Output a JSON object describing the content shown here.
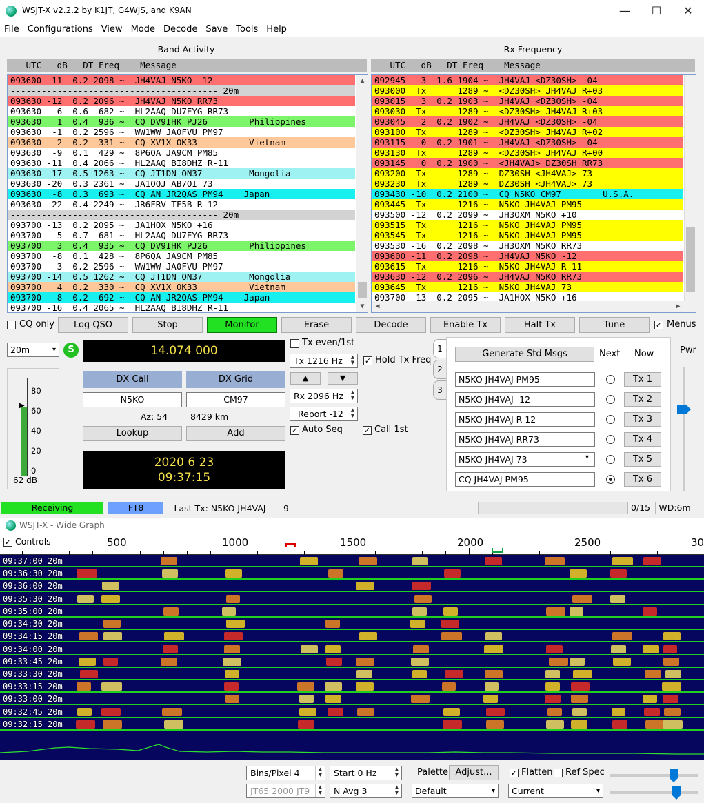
{
  "window": {
    "title": "WSJT-X   v2.2.2   by K1JT, G4WJS, and K9AN",
    "minimize": "—",
    "maximize": "☐",
    "close": "✕"
  },
  "menu": [
    "File",
    "Configurations",
    "View",
    "Mode",
    "Decode",
    "Save",
    "Tools",
    "Help"
  ],
  "band_activity": {
    "label": "Band Activity",
    "header": " UTC   dB   DT Freq    Message",
    "rows": [
      {
        "text": "093600 -11  0.2 2098 ~  JH4VAJ N5KO -12",
        "bg": "#ff6f6f"
      },
      {
        "text": "---------------------------------------- 20m",
        "bg": "#d3d3d3"
      },
      {
        "text": "093630 -12  0.2 2096 ~  JH4VAJ N5KO RR73",
        "bg": "#ff6f6f"
      },
      {
        "text": "093630   6  0.6  682 ~  HL2AAQ DU7EYG RR73",
        "bg": "#ffffff"
      },
      {
        "text": "093630   1  0.4  936 ~  CQ DV9IHK PJ26        Philippines",
        "bg": "#7cf56a"
      },
      {
        "text": "093630  -1  0.2 2596 ~  WW1WW JA0FVU PM97",
        "bg": "#ffffff"
      },
      {
        "text": "093630   2  0.2  331 ~  CQ XV1X OK33          Vietnam",
        "bg": "#ffc89a"
      },
      {
        "text": "093630  -9  0.1  429 ~  8P6QA JA9CM PM85",
        "bg": "#ffffff"
      },
      {
        "text": "093630 -11  0.4 2066 ~  HL2AAQ BI8DHZ R-11",
        "bg": "#ffffff"
      },
      {
        "text": "093630 -17  0.5 1263 ~  CQ JT1DN ON37         Mongolia",
        "bg": "#9ff2f2"
      },
      {
        "text": "093630 -20  0.3 2361 ~  JA1OQJ AB7OI 73",
        "bg": "#ffffff"
      },
      {
        "text": "093630  -8  0.3  693 ~  CQ AN JR2QAS PM94    Japan",
        "bg": "#18f0f0"
      },
      {
        "text": "093630 -22  0.4 2249 ~  JR6FRV TF5B R-12",
        "bg": "#ffffff"
      },
      {
        "text": "---------------------------------------- 20m",
        "bg": "#d3d3d3"
      },
      {
        "text": "093700 -13  0.2 2095 ~  JA1HOX N5KO +16",
        "bg": "#ffffff"
      },
      {
        "text": "093700   5  0.7  681 ~  HL2AAQ DU7EYG RR73",
        "bg": "#ffffff"
      },
      {
        "text": "093700   3  0.4  935 ~  CQ DV9IHK PJ26        Philippines",
        "bg": "#7cf56a"
      },
      {
        "text": "093700  -8  0.1  428 ~  8P6QA JA9CM PM85",
        "bg": "#ffffff"
      },
      {
        "text": "093700  -3  0.2 2596 ~  WW1WW JA0FVU PM97",
        "bg": "#ffffff"
      },
      {
        "text": "093700 -14  0.5 1262 ~  CQ JT1DN ON37         Mongolia",
        "bg": "#9ff2f2"
      },
      {
        "text": "093700   4  0.2  330 ~  CQ XV1X OK33          Vietnam",
        "bg": "#ffc89a"
      },
      {
        "text": "093700  -8  0.2  692 ~  CQ AN JR2QAS PM94    Japan",
        "bg": "#18f0f0"
      },
      {
        "text": "093700 -16  0.4 2065 ~  HL2AAQ BI8DHZ R-11",
        "bg": "#ffffff"
      }
    ]
  },
  "rx_frequency": {
    "label": "Rx Frequency",
    "header": " UTC   dB   DT Freq    Message",
    "rows": [
      {
        "text": "092945   3 -1.6 1904 ~  JH4VAJ <DZ30SH> -04",
        "bg": "#ff6f6f"
      },
      {
        "text": "093000  Tx      1289 ~  <DZ30SH> JH4VAJ R+03",
        "bg": "#ffff00"
      },
      {
        "text": "093015   3  0.2 1903 ~  JH4VAJ <DZ30SH> -04",
        "bg": "#ff6f6f"
      },
      {
        "text": "093030  Tx      1289 ~  <DZ30SH> JH4VAJ R+03",
        "bg": "#ffff00"
      },
      {
        "text": "093045   2  0.2 1902 ~  JH4VAJ <DZ30SH> -04",
        "bg": "#ff6f6f"
      },
      {
        "text": "093100  Tx      1289 ~  <DZ30SH> JH4VAJ R+02",
        "bg": "#ffff00"
      },
      {
        "text": "093115   0  0.2 1901 ~  JH4VAJ <DZ30SH> -04",
        "bg": "#ff6f6f"
      },
      {
        "text": "093130  Tx      1289 ~  <DZ30SH> JH4VAJ R+00",
        "bg": "#ffff00"
      },
      {
        "text": "093145   0  0.2 1900 ~  <JH4VAJ> DZ30SH RR73",
        "bg": "#ff6f6f"
      },
      {
        "text": "093200  Tx      1289 ~  DZ30SH <JH4VAJ> 73",
        "bg": "#ffff00"
      },
      {
        "text": "093230  Tx      1289 ~  DZ30SH <JH4VAJ> 73",
        "bg": "#ffff00"
      },
      {
        "text": "093430 -10  0.2 2100 ~  CQ N5KO CM97        U.S.A.",
        "bg": "#18f0f0"
      },
      {
        "text": "093445  Tx      1216 ~  N5KO JH4VAJ PM95",
        "bg": "#ffff00"
      },
      {
        "text": "093500 -12  0.2 2099 ~  JH3OXM N5KO +10",
        "bg": "#ffffff"
      },
      {
        "text": "093515  Tx      1216 ~  N5KO JH4VAJ PM95",
        "bg": "#ffff00"
      },
      {
        "text": "093545  Tx      1216 ~  N5KO JH4VAJ PM95",
        "bg": "#ffff00"
      },
      {
        "text": "093530 -16  0.2 2098 ~  JH3OXM N5KO RR73",
        "bg": "#ffffff"
      },
      {
        "text": "093600 -11  0.2 2098 ~  JH4VAJ N5KO -12",
        "bg": "#ff6f6f"
      },
      {
        "text": "093615  Tx      1216 ~  N5KO JH4VAJ R-11",
        "bg": "#ffff00"
      },
      {
        "text": "093630 -12  0.2 2096 ~  JH4VAJ N5KO RR73",
        "bg": "#ff6f6f"
      },
      {
        "text": "093645  Tx      1216 ~  N5KO JH4VAJ 73",
        "bg": "#ffff00"
      },
      {
        "text": "093700 -13  0.2 2095 ~  JA1HOX N5KO +16",
        "bg": "#ffffff"
      }
    ]
  },
  "controls_row": {
    "cq_only": "CQ only",
    "log_qso": "Log QSO",
    "stop": "Stop",
    "monitor": "Monitor",
    "erase": "Erase",
    "decode": "Decode",
    "enable_tx": "Enable Tx",
    "halt_tx": "Halt Tx",
    "tune": "Tune",
    "menus": "Menus"
  },
  "left_panel": {
    "band": "20m",
    "s_button": "S",
    "frequency": "14.074 000",
    "dx_call_label": "DX Call",
    "dx_grid_label": "DX Grid",
    "dx_call": "N5KO",
    "dx_grid": "CM97",
    "azimuth": "Az: 54",
    "distance": "8429 km",
    "lookup": "Lookup",
    "add": "Add",
    "date": "2020 6 23",
    "time": "09:37:15",
    "meter_ticks": [
      "80",
      "60",
      "40",
      "20",
      "0"
    ],
    "meter_level_db": 62,
    "meter_reading": "62 dB"
  },
  "tx_panel": {
    "tx_even": "Tx even/1st",
    "tx_freq": "Tx  1216  Hz",
    "hold_tx_freq": "Hold Tx Freq",
    "up": "▲",
    "down": "▼",
    "rx_freq": "Rx  2096  Hz",
    "report": "Report -12",
    "auto_seq": "Auto Seq",
    "call_1st": "Call 1st"
  },
  "msg_panel": {
    "tabs": [
      "1",
      "2",
      "3"
    ],
    "generate": "Generate Std Msgs",
    "next": "Next",
    "now": "Now",
    "pwr": "Pwr",
    "messages": [
      {
        "text": "N5KO JH4VAJ PM95",
        "btn": "Tx 1",
        "selected": false
      },
      {
        "text": "N5KO JH4VAJ -12",
        "btn": "Tx 2",
        "selected": false
      },
      {
        "text": "N5KO JH4VAJ R-12",
        "btn": "Tx 3",
        "selected": false
      },
      {
        "text": "N5KO JH4VAJ RR73",
        "btn": "Tx 4",
        "selected": false
      },
      {
        "text": "N5KO JH4VAJ 73",
        "btn": "Tx 5",
        "selected": false
      },
      {
        "text": "CQ JH4VAJ PM95",
        "btn": "Tx 6",
        "selected": true
      }
    ]
  },
  "status_bar": {
    "receiving": "Receiving",
    "mode": "FT8",
    "last_tx": "Last Tx: N5KO JH4VAJ 73",
    "count": "9",
    "progress": "0/15",
    "wd": "WD:6m"
  },
  "wide_graph": {
    "title": "WSJT-X - Wide Graph",
    "controls": "Controls",
    "freq_labels": [
      "500",
      "1000",
      "1500",
      "2000",
      "2500",
      "30"
    ],
    "rows": [
      "09:37:00  20m",
      "09:36:30  20m",
      "09:36:00  20m",
      "09:35:30  20m",
      "09:35:00  20m",
      "09:34:30  20m",
      "09:34:15  20m",
      "09:34:00  20m",
      "09:33:45  20m",
      "09:33:30  20m",
      "09:33:15  20m",
      "09:33:00  20m",
      "09:32:45  20m",
      "09:32:15  20m"
    ],
    "bins_pixel": "Bins/Pixel  4",
    "start": "Start 0 Hz",
    "mode_label": "JT65  2000  JT9",
    "n_avg": "N Avg 3",
    "palette": "Palette",
    "adjust": "Adjust...",
    "palette_value": "Default",
    "flatten": "Flatten",
    "ref_spec": "Ref Spec",
    "spec_value": "Current"
  },
  "colors": {
    "monitor_on": "#22e022",
    "receiving": "#22e022",
    "mode": "#6ea0ff",
    "freq_display_bg": "#000000",
    "freq_display_fg": "#f5e04a"
  }
}
